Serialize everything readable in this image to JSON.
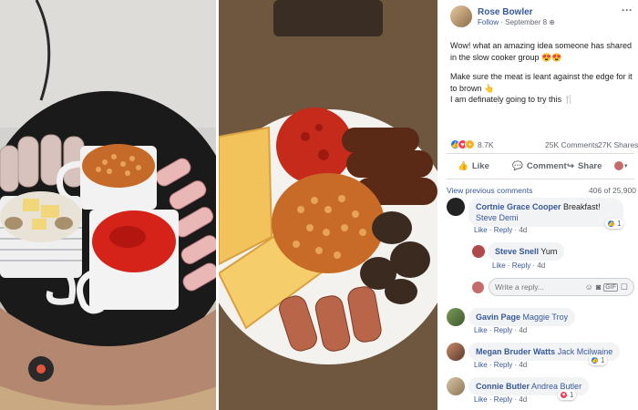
{
  "post": {
    "author": "Rose Bowler",
    "follow_label": "Follow",
    "date": "September 8",
    "text_line1": "Wow! what an amazing idea someone has shared in the slow cooker group 😍😍",
    "text_line2": "Make sure the meat is leant against the edge for it to brown 👆",
    "text_line3": "I am definately going to try this 🍴",
    "reaction_count": "8.7K",
    "comments_count": "25K Comments",
    "shares_count": "27K Shares",
    "more": "···"
  },
  "actions": {
    "like": "Like",
    "comment": "Comment",
    "share": "Share"
  },
  "comments_header": {
    "view_previous": "View previous comments",
    "progress": "406 of 25,900"
  },
  "comments": [
    {
      "name": "Cortnie Grace Cooper",
      "text": "Breakfast!",
      "tag": "Steve Demi",
      "like": "Like",
      "reply": "Reply",
      "time": "4d",
      "reactions": "1"
    },
    {
      "name": "Steve Snell",
      "text": "Yum",
      "tag": "",
      "like": "Like",
      "reply": "Reply",
      "time": "4d"
    },
    {
      "name": "Gavin Page",
      "text": "",
      "tag": "Maggie Troy",
      "like": "Like",
      "reply": "Reply",
      "time": "4d"
    },
    {
      "name": "Megan Bruder Watts",
      "text": "",
      "tag": "Jack Mcilwaine",
      "like": "Like",
      "reply": "Reply",
      "time": "4d",
      "reactions": "1"
    },
    {
      "name": "Connie Butler",
      "text": "",
      "tag": "Andrea Butler",
      "like": "Like",
      "reply": "Reply",
      "time": "4d",
      "reactions": "1"
    }
  ],
  "reply_box": {
    "placeholder": "Write a reply..."
  },
  "colors": {
    "fb_blue": "#385898",
    "like_blue": "#1877f2",
    "love_red": "#f33e58"
  }
}
